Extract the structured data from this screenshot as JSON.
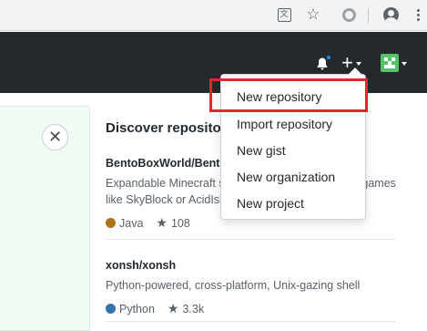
{
  "browser": {
    "icons": [
      "translate-icon",
      "star-icon",
      "extension-icon",
      "profile-icon",
      "kebab-menu-icon"
    ],
    "translate_glyph": "文"
  },
  "header": {
    "icons": [
      "bell-icon",
      "plus-icon",
      "avatar"
    ],
    "background": "#24292e"
  },
  "dropdown": {
    "items": [
      {
        "label": "New repository"
      },
      {
        "label": "Import repository"
      },
      {
        "label": "New gist"
      },
      {
        "label": "New organization"
      },
      {
        "label": "New project"
      }
    ],
    "highlighted_item": "New repository",
    "highlight_color": "#e0292c"
  },
  "discover": {
    "title": "Discover repositories",
    "repos": [
      {
        "name": "BentoBoxWorld/BentoBox",
        "description_line1": "Expandable Minecraft server plugin for island-type games",
        "description_line2": "like SkyBlock or AcidIsland",
        "language": "Java",
        "language_color": "#b07219",
        "stars": "108"
      },
      {
        "name": "xonsh/xonsh",
        "description_line1": "Python-powered, cross-platform, Unix-gazing shell",
        "language": "Python",
        "language_color": "#3572A5",
        "stars": "3.3k"
      }
    ]
  },
  "colors": {
    "left_panel": "#f1fbf4",
    "avatar_green": "#56c26a"
  }
}
